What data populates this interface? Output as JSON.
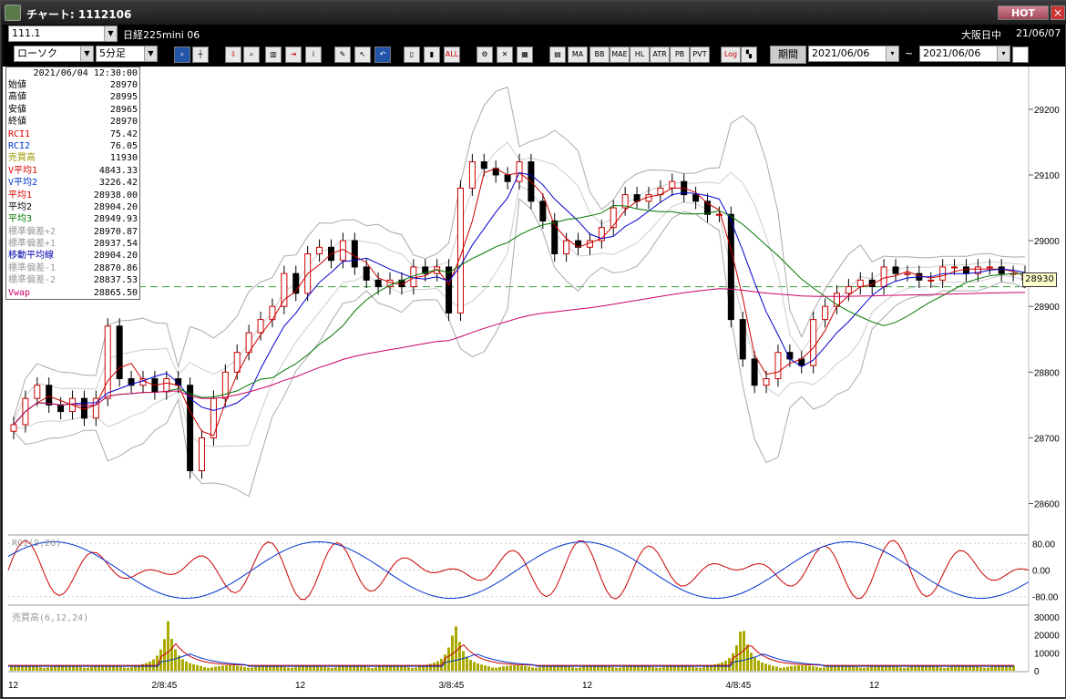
{
  "window": {
    "title": "チャート: 1112106",
    "hot": "HOT",
    "close": "×"
  },
  "toolbar1": {
    "symbol": "111.1",
    "instrument": "日経225mini 06",
    "session": "大阪日中",
    "date": "21/06/07"
  },
  "toolbar2": {
    "chart_type": "ローソク",
    "interval": "5分足",
    "period_label": "期間",
    "from_date": "2021/06/06",
    "tilde": "~",
    "to_date": "2021/06/06",
    "buttons": [
      "zoom",
      "cursor",
      "download",
      "zoom-2",
      "compare",
      "exit",
      "info",
      "pen",
      "arrow",
      "undo",
      "box-a",
      "box-b",
      "ALL",
      "tools",
      "wrench",
      "palette",
      "MA",
      "MA",
      "BB",
      "MAE",
      "HL",
      "ATR",
      "PB",
      "PVT",
      "Log",
      "grid"
    ],
    "button_labels": {
      "all": "ALL",
      "ma": "MA",
      "bb": "BB",
      "mae": "MAE",
      "hl": "HL",
      "atr": "ATR",
      "pb": "PB",
      "pvt": "PVT",
      "log": "Log"
    }
  },
  "info": {
    "datetime": "2021/06/04  12:30:00",
    "rows": [
      {
        "k": "始値",
        "v": "28970",
        "color": "#000"
      },
      {
        "k": "高値",
        "v": "28995",
        "color": "#000"
      },
      {
        "k": "安値",
        "v": "28965",
        "color": "#000"
      },
      {
        "k": "終値",
        "v": "28970",
        "color": "#000"
      },
      {
        "k": "RCI1",
        "v": "75.42",
        "color": "#d00"
      },
      {
        "k": "RCI2",
        "v": "76.05",
        "color": "#0033cc"
      },
      {
        "k": "売買高",
        "v": "11930",
        "color": "#999900"
      },
      {
        "k": "V平均1",
        "v": "4843.33",
        "color": "#d00"
      },
      {
        "k": "V平均2",
        "v": "3226.42",
        "color": "#0033cc"
      },
      {
        "k": "平均1",
        "v": "28938.00",
        "color": "#d00"
      },
      {
        "k": "平均2",
        "v": "28904.20",
        "color": "#000"
      },
      {
        "k": "平均3",
        "v": "28949.93",
        "color": "#007700"
      },
      {
        "k": "標準偏差+2",
        "v": "28970.87",
        "color": "#999"
      },
      {
        "k": "標準偏差+1",
        "v": "28937.54",
        "color": "#999"
      },
      {
        "k": "移動平均線",
        "v": "28904.20",
        "color": "#0000aa"
      },
      {
        "k": "標準偏差-1",
        "v": "28870.86",
        "color": "#999"
      },
      {
        "k": "標準偏差-2",
        "v": "28837.53",
        "color": "#999"
      },
      {
        "k": "Vwap",
        "v": "28865.50",
        "color": "#cc0066"
      }
    ]
  },
  "price_tag": "28930",
  "rci_label": "RCI(9,26)",
  "vol_label": "売買高(6,12,24)",
  "colors": {
    "up": "#cc0000",
    "down": "#000000",
    "ma_fast": "#cc0000",
    "ma_mid": "#0000cc",
    "ma_slow": "#007700",
    "vwap": "#cc0066",
    "band": "#999999",
    "volume": "#aaaa00"
  },
  "chart_data": [
    {
      "type": "line",
      "title": "",
      "ylabel": "",
      "y_ticks": [
        29200,
        29100,
        29000,
        28900,
        28800,
        28700,
        28600
      ],
      "ylim": [
        28555,
        29265
      ],
      "x_ticks": [
        "12",
        "2/8:45",
        "12",
        "3/8:45",
        "12",
        "4/8:45",
        "12"
      ],
      "reference_line": 28930,
      "series": [
        {
          "name": "終値",
          "values": [
            28720,
            28760,
            28780,
            28750,
            28740,
            28760,
            28730,
            28760,
            28870,
            28790,
            28780,
            28790,
            28770,
            28790,
            28780,
            28650,
            28700,
            28760,
            28800,
            28830,
            28860,
            28880,
            28900,
            28950,
            28920,
            28980,
            28990,
            28970,
            29000,
            28960,
            28940,
            28930,
            28940,
            28930,
            28960,
            28950,
            28960,
            28890,
            29080,
            29120,
            29110,
            29100,
            29090,
            29120,
            29060,
            29030,
            28980,
            29000,
            28990,
            29000,
            29020,
            29050,
            29070,
            29060,
            29070,
            29080,
            29090,
            29070,
            29060,
            29040,
            29040,
            28880,
            28820,
            28780,
            28790,
            28830,
            28820,
            28810,
            28880,
            28900,
            28920,
            28930,
            28940,
            28930,
            28960,
            28950,
            28950,
            28940,
            28940,
            28960,
            28960,
            28950,
            28960,
            28960,
            28950,
            28950,
            28940
          ]
        }
      ]
    },
    {
      "type": "line",
      "title": "",
      "y_ticks": [
        80,
        0,
        -80
      ],
      "ylim": [
        -100,
        100
      ],
      "series": [
        {
          "name": "RCI1"
        },
        {
          "name": "RCI2"
        }
      ]
    },
    {
      "type": "bar",
      "title": "",
      "y_ticks": [
        30000,
        20000,
        10000,
        0
      ],
      "ylim": [
        0,
        35000
      ],
      "series": [
        {
          "name": "売買高"
        }
      ]
    }
  ]
}
